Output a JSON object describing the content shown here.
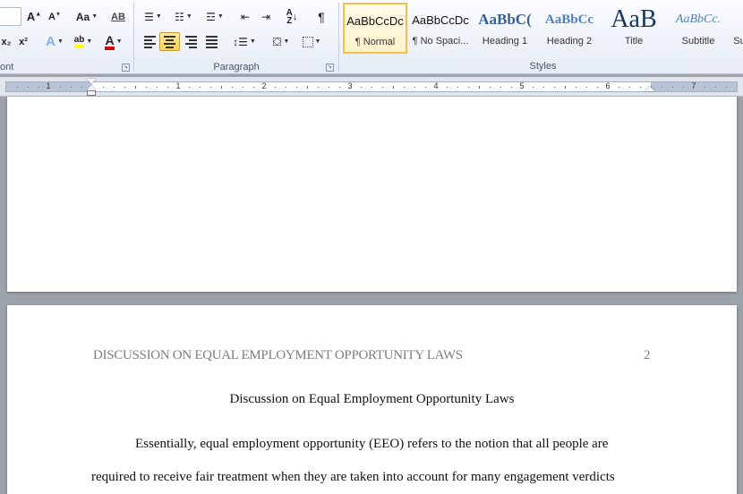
{
  "ribbon": {
    "groups": {
      "font": {
        "label": "ont"
      },
      "paragraph": {
        "label": "Paragraph"
      },
      "styles": {
        "label": "Styles"
      }
    },
    "font_buttons": {
      "change_case_label": "Aa",
      "subscript_label": "x₂",
      "superscript_label": "x²"
    },
    "styles_gallery": [
      {
        "preview": "AaBbCcDc",
        "name": "¶ Normal",
        "selected": true
      },
      {
        "preview": "AaBbCcDc",
        "name": "¶ No Spaci..."
      },
      {
        "preview": "AaBbC(",
        "name": "Heading 1"
      },
      {
        "preview": "AaBbCc",
        "name": "Heading 2"
      },
      {
        "preview": "AaB",
        "name": "Title"
      },
      {
        "preview": "AaBbCc.",
        "name": "Subtitle"
      },
      {
        "preview": "",
        "name": "Su"
      }
    ]
  },
  "ruler": {
    "numbers": [
      "1",
      "1",
      "2",
      "3",
      "4",
      "5",
      "6",
      "7"
    ]
  },
  "document": {
    "page2": {
      "running_head": "DISCUSSION ON EQUAL EMPLOYMENT OPPORTUNITY LAWS",
      "page_number": "2",
      "title": "Discussion on Equal Employment Opportunity Laws",
      "body_line1": "Essentially, equal employment opportunity (EEO) refers to the notion that all people are",
      "body_line2": "required to receive fair treatment when they are taken into account for many engagement verdicts"
    }
  },
  "colors": {
    "ribbon_bg": "#e6ecf5",
    "selected_style_border": "#f0c24a",
    "active_button": "#ffd35a",
    "heading_blue": "#365f91",
    "title_navy": "#17365d",
    "header_gray": "#7d7d7d",
    "workspace_bg": "#9ca3ab"
  }
}
